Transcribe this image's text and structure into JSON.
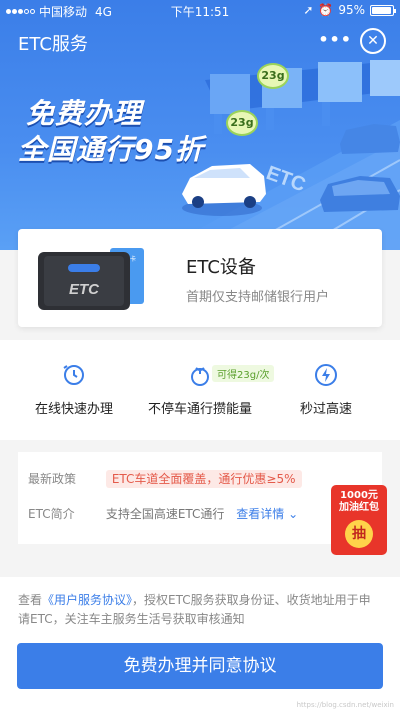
{
  "status_bar": {
    "carrier": "中国移动",
    "network": "4G",
    "time": "下午11:51",
    "battery": "95%"
  },
  "navbar": {
    "title": "ETC服务",
    "more": "•••",
    "close": "✕"
  },
  "hero": {
    "slogan_line1": "免费办理",
    "slogan_line2": "全国通行95折",
    "badge_top": "23g",
    "badge_mid": "23g"
  },
  "product": {
    "title": "ETC设备",
    "subtitle": "首期仅支持邮储银行用户",
    "device_label": "ETC",
    "card_label": "银行卡"
  },
  "features": {
    "tag": "可得23g/次",
    "items": [
      {
        "label": "在线快速办理",
        "icon": "clock-icon"
      },
      {
        "label": "不停车通行攒能量",
        "icon": "sprout-icon"
      },
      {
        "label": "秒过高速",
        "icon": "lightning-icon"
      }
    ]
  },
  "policy": {
    "row1_label": "最新政策",
    "row1_value": "ETC车道全面覆盖，通行优惠≥5%",
    "row2_label": "ETC简介",
    "row2_value": "支持全国高速ETC通行",
    "row2_link": "查看详情",
    "gift_line1": "1000元",
    "gift_line2": "加油红包",
    "gift_cta": "抽"
  },
  "agreement": {
    "prefix": "查看",
    "link": "《用户服务协议》",
    "suffix": "，授权ETC服务获取身份证、收货地址用于申请ETC，关注车主服务生活号获取审核通知",
    "button": "免费办理并同意协议",
    "watermark": "https://blog.csdn.net/weixin"
  },
  "colors": {
    "primary": "#3b7ee8",
    "highlight_red": "#e45a4a",
    "gift_red": "#e8352a",
    "energy_green": "#5aa02c"
  }
}
